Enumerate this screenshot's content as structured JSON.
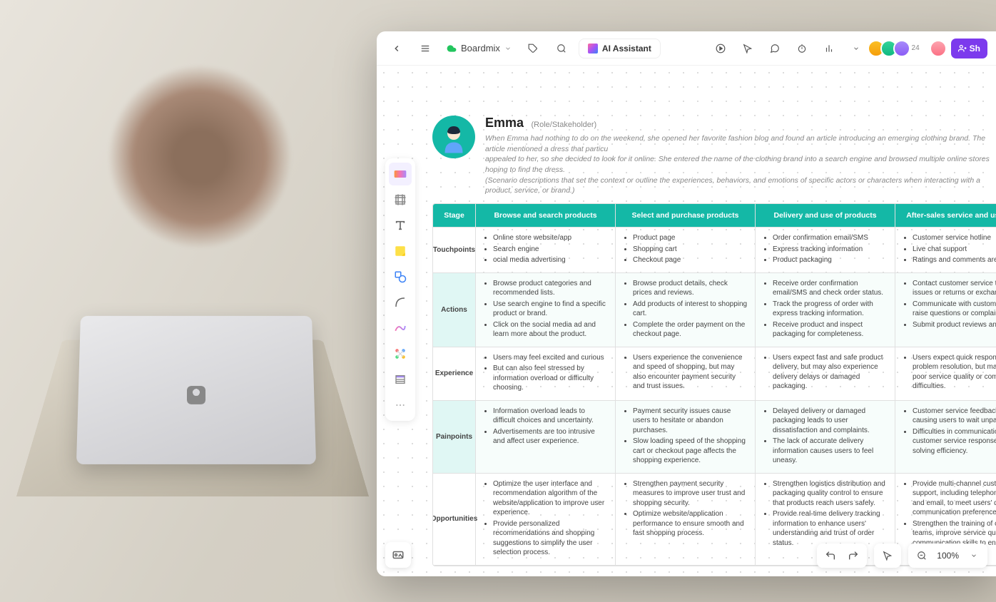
{
  "header": {
    "file_name": "Boardmix",
    "ai_assistant": "AI Assistant",
    "collaborator_count": "24",
    "share_label": "Sh"
  },
  "persona": {
    "name": "Emma",
    "role": "(Role/Stakeholder)",
    "description_line1": "When Emma had nothing to do on the weekend, she opened her favorite fashion blog and found an article introducing an emerging clothing brand. The article mentioned a dress that particu",
    "description_line2": "appealed to her, so she decided to look for it online. She entered the name of the clothing brand into a search engine and browsed multiple online stores hoping to find the dress.",
    "description_line3": "(Scenario descriptions that set the context or outline the experiences, behaviors, and emotions of specific actors or characters when interacting with a product, service, or brand.)"
  },
  "journey": {
    "columns": [
      "Stage",
      "Browse and search products",
      "Select and purchase products",
      "Delivery and use of products",
      "After-sales service and user feed"
    ],
    "rows": [
      {
        "label": "Touchpoints",
        "cells": [
          [
            "Online store website/app",
            "Search engine",
            "ocial media advertising"
          ],
          [
            "Product page",
            "Shopping cart",
            "Checkout page"
          ],
          [
            "Order confirmation email/SMS",
            "Express tracking information",
            "Product packaging"
          ],
          [
            "Customer service hotline",
            "Live chat support",
            "Ratings and comments area"
          ]
        ]
      },
      {
        "label": "Actions",
        "cells": [
          [
            "Browse product categories and recommended lists.",
            "Use search engine to find a specific product or brand.",
            "Click on the social media ad and learn more about the product."
          ],
          [
            "Browse product details, check prices and reviews.",
            "Add products of interest to shopping cart.",
            "Complete the order payment on the checkout page."
          ],
          [
            "Receive order confirmation email/SMS and check order status.",
            "Track the progress of order with express tracking information.",
            "Receive product and inspect packaging for completeness."
          ],
          [
            "Contact customer service to resol issues or returns or exchanges.",
            "Communicate with customer serv to raise questions or complaints.",
            "Submit product reviews and user"
          ]
        ]
      },
      {
        "label": "Experience",
        "cells": [
          [
            "Users may feel excited and curious",
            "But can also feel stressed by information overload or difficulty choosing."
          ],
          [
            "Users experience the convenience and speed of shopping, but may also encounter payment security and trust issues."
          ],
          [
            "Users expect fast and safe product delivery, but may also experience delivery delays or damaged packaging."
          ],
          [
            "Users expect quick responses and problem resolution, but may be d by poor service quality or commu difficulties."
          ]
        ]
      },
      {
        "label": "Painpoints",
        "cells": [
          [
            "Information overload leads to difficult choices and uncertainty.",
            "Advertisements are too intrusive and affect user experience."
          ],
          [
            "Payment security issues cause users to hesitate or abandon purchases.",
            "Slow loading speed of the shopping cart or checkout page affects the shopping experience."
          ],
          [
            "Delayed delivery or damaged packaging leads to user dissatisfaction and complaints.",
            "The lack of accurate delivery information causes users to feel uneasy."
          ],
          [
            "Customer service feedback takes t causing users to wait unpatiently.",
            "Difficulties in communication or u customer service responses affect solving efficiency."
          ]
        ]
      },
      {
        "label": "Opportunities",
        "cells": [
          [
            "Optimize the user interface and recommendation algorithm of the website/application to improve user experience.",
            "Provide personalized recommendations and shopping suggestions to simplify the user selection process."
          ],
          [
            "Strengthen payment security measures to improve user trust and shopping security.",
            "Optimize website/application performance to ensure smooth and fast shopping process."
          ],
          [
            "Strengthen logistics distribution and packaging quality control to ensure that products reach users safely.",
            "Provide real-time delivery tracking information to enhance users' understanding and trust of order status."
          ],
          [
            "Provide multi-channel customer s support, including telephone, onli and email, to meet users' different communication preferences.",
            "Strengthen the training of custom teams, improve service quality an communication skills to enhance satisfaction and loyalty."
          ]
        ]
      }
    ]
  },
  "zoom": "100%"
}
